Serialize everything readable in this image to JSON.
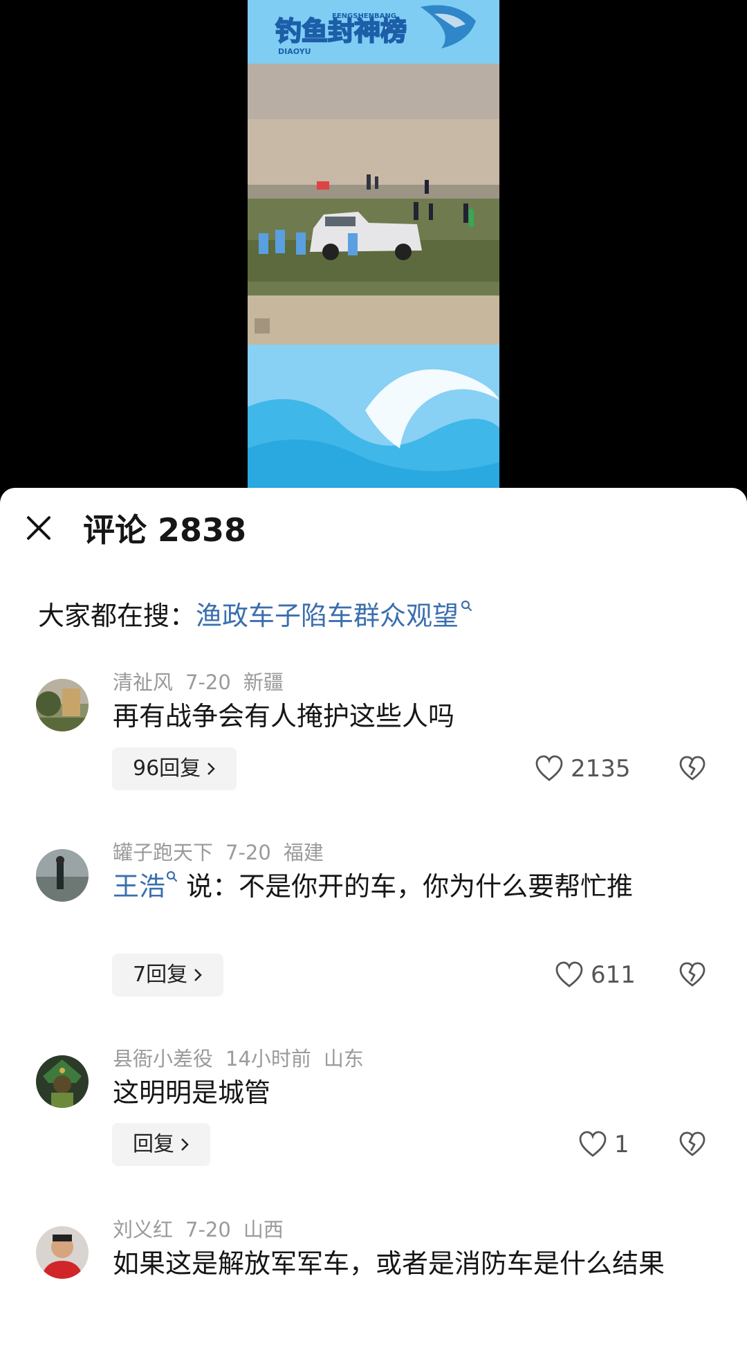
{
  "video": {
    "banner_title": "钓鱼封神榜",
    "banner_sub_1": "FENGSHENBANG",
    "banner_sub_2": "DIAOYU"
  },
  "comments_sheet": {
    "title": "评论 2838",
    "search_label": "大家都在搜：",
    "search_term": "渔政车子陷车群众观望"
  },
  "comments": [
    {
      "user": "清祉风",
      "time": "7-20",
      "location": "新疆",
      "text": "再有战争会有人掩护这些人吗",
      "replies": "96回复",
      "likes": "2135"
    },
    {
      "user": "罐子跑天下",
      "time": "7-20",
      "location": "福建",
      "mention": "王浩",
      "text": "说：不是你开的车，你为什么要帮忙推",
      "replies": "7回复",
      "likes": "611"
    },
    {
      "user": "县衙小差役",
      "time": "14小时前",
      "location": "山东",
      "text": "这明明是城管",
      "replies": "回复",
      "likes": "1"
    },
    {
      "user": "刘义红",
      "time": "7-20",
      "location": "山西",
      "text": "如果这是解放军军车，或者是消防车是什么结果"
    }
  ]
}
